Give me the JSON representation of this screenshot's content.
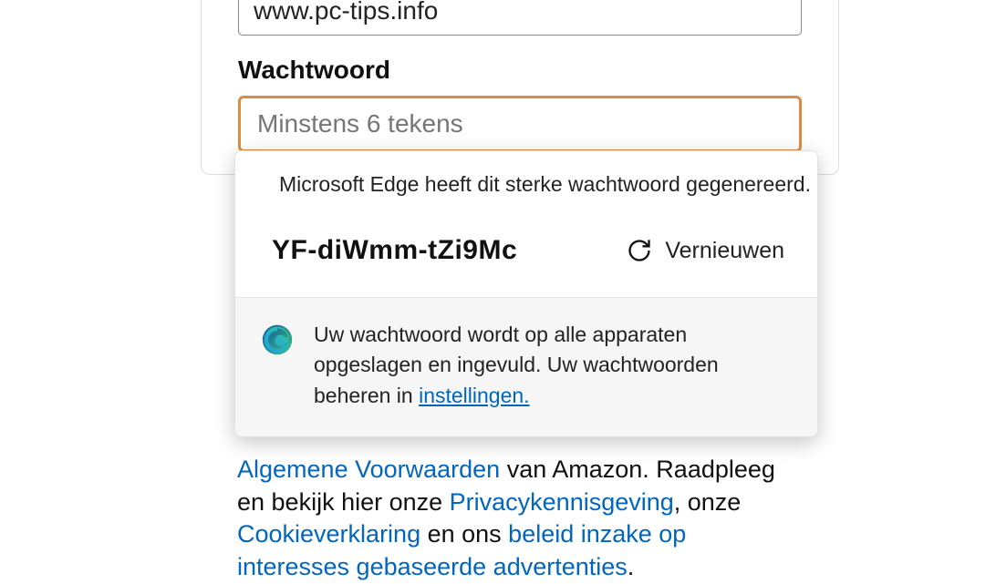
{
  "form": {
    "website_value": "www.pc-tips.info",
    "password_label": "Wachtwoord",
    "password_placeholder": "Minstens 6 tekens"
  },
  "popup": {
    "header_text": "Microsoft Edge heeft dit sterke wachtwoord gegenereerd.",
    "generated_password": "YF-diWmm-tZi9Mc",
    "refresh_label": "Vernieuwen",
    "save_text_1": "Uw wachtwoord wordt op alle apparaten opgeslagen en ingevuld. Uw wachtwoorden beheren in  ",
    "settings_link": "instellingen."
  },
  "footer": {
    "link1": "Algemene Voorwaarden",
    "seg1": " van Amazon. Raadpleeg en bekijk hier onze ",
    "link2": "Privacykennisgeving",
    "seg2": ", onze ",
    "link3": "Cookieverklaring",
    "seg3": " en ons ",
    "link4": "beleid inzake op interesses gebaseerde advertenties",
    "seg4": "."
  }
}
